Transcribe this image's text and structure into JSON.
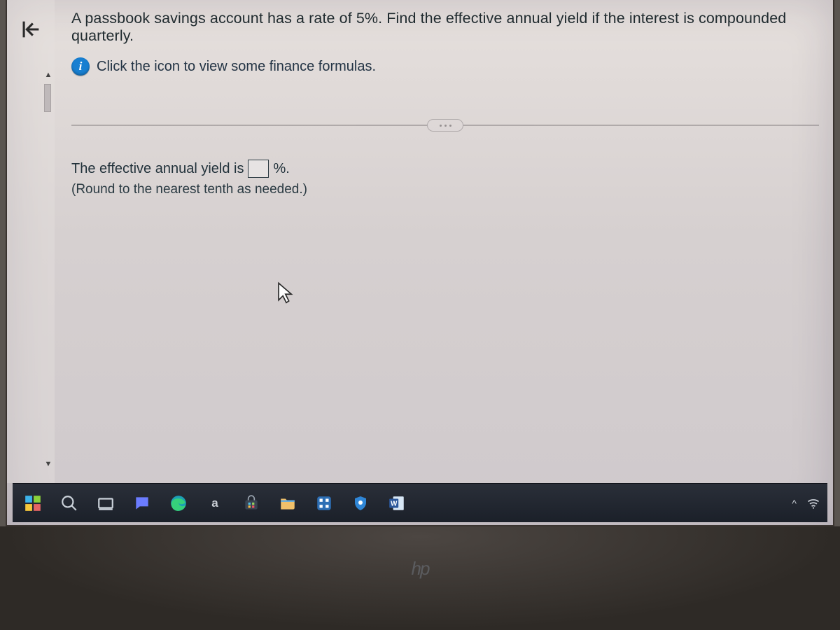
{
  "sidebar": {
    "collapse_tooltip": "Collapse"
  },
  "question": {
    "text": "A passbook savings account has a rate of 5%. Find the effective annual yield if the interest is compounded quarterly."
  },
  "info": {
    "badge": "i",
    "text": "Click the icon to view some finance formulas."
  },
  "divider": {
    "menu_tooltip": "More"
  },
  "answer": {
    "prefix": "The effective annual yield is",
    "input_value": "",
    "suffix": "%.",
    "hint": "(Round to the nearest tenth as needed.)"
  },
  "taskbar": {
    "start_tooltip": "Start",
    "search_tooltip": "Search",
    "desktop_peek_tooltip": "Show desktop",
    "chat_tooltip": "Chat",
    "edge_tooltip": "Microsoft Edge",
    "amazon_tooltip": "Amazon",
    "store_tooltip": "Microsoft Store",
    "explorer_tooltip": "File Explorer",
    "settings_tooltip": "Settings",
    "security_tooltip": "Windows Security",
    "word_tooltip": "Word"
  },
  "tray": {
    "overflow": "^",
    "wifi_tooltip": "Wi-Fi"
  },
  "branding": {
    "logo": "hp"
  }
}
